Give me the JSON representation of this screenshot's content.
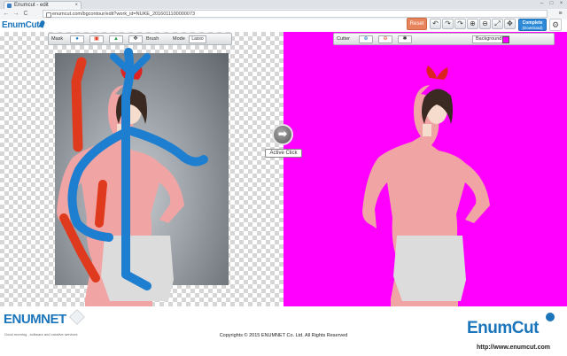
{
  "browser": {
    "tab_title": "Enumcut - edit",
    "tab_close": "×",
    "window_buttons": [
      "–",
      "□",
      "×"
    ],
    "back": "←",
    "forward": "→",
    "reload": "C",
    "url": "enumcut.com/bgcontour/edit?work_id=NUKE_2016011100000073",
    "menu": "≡"
  },
  "header": {
    "logo": "EnumCut",
    "reset_label": "Reset",
    "tools": [
      "↶",
      "↷",
      "↷",
      "⊕",
      "⊖",
      "⤢",
      "✥"
    ],
    "complete_label": "Complete",
    "complete_sub": "(Download)",
    "settings": "⚙"
  },
  "left_toolbar": {
    "mask_label": "Mask",
    "brush_label": "Brush",
    "mode_label": "Mode",
    "mode_value": "Lasso"
  },
  "right_toolbar": {
    "cutter_label": "Cutter",
    "background_label": "Background",
    "background_color": "#ff00ff"
  },
  "active_click": {
    "button": "➡",
    "label": "Active Click"
  },
  "footer": {
    "company": "ENUMNET",
    "tagline": "Good morning , software and creative services",
    "copyright": "Copyrights © 2015 ENUMNET Co. Ltd. All Rights Reserved",
    "brand": "EnumCut",
    "website": "http://www.enumcut.com"
  },
  "colors": {
    "accent": "#1b75bb",
    "reset": "#e8845b",
    "complete": "#2d8ad8",
    "background_magenta": "#ff00ff",
    "foreground_stroke": "#1e7fd0",
    "background_stroke": "#e03a1e"
  }
}
